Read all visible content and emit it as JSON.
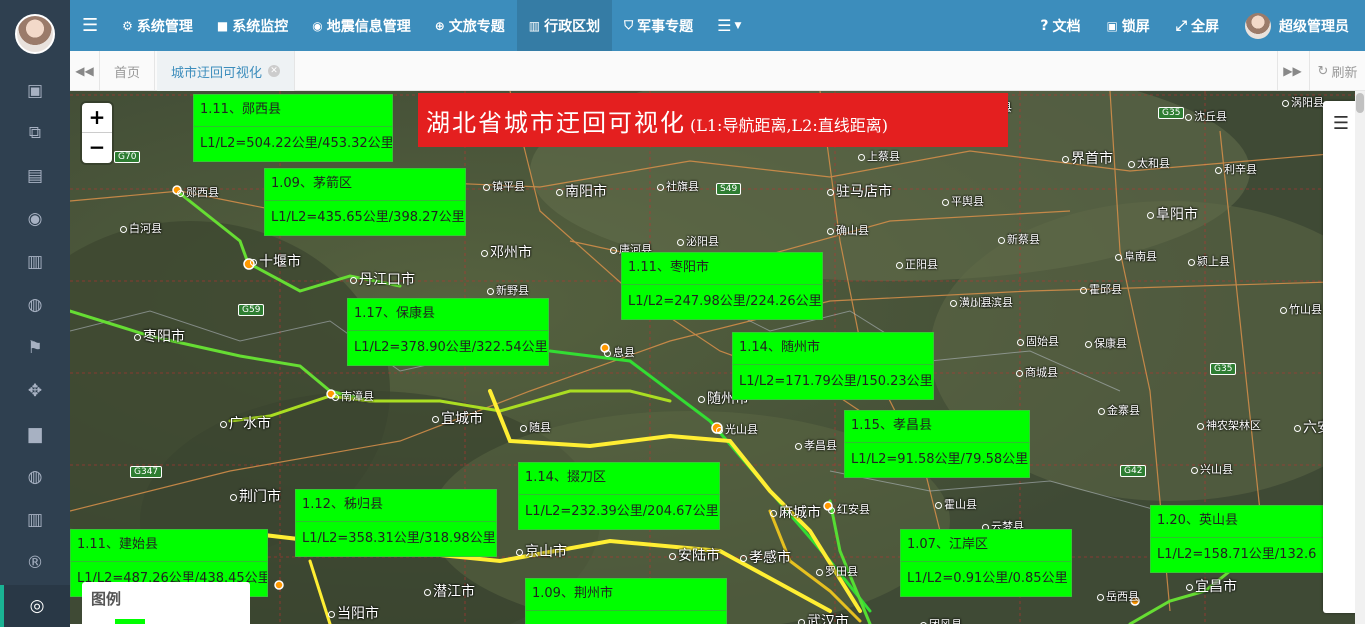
{
  "sidebar": {
    "icons": [
      "screen-icon",
      "layers-icon",
      "map-icon",
      "marker-icon",
      "bar-chart-icon",
      "globe-icon",
      "flag-icon",
      "move-icon",
      "area-chart-icon",
      "globe-icon",
      "bar-chart-icon",
      "registered-icon",
      "lifebuoy-icon"
    ]
  },
  "topbar": {
    "menu": [
      {
        "label": "系统管理",
        "icon": "gear-icon",
        "glyph": "⚙"
      },
      {
        "label": "系统监控",
        "icon": "video-icon",
        "glyph": "■"
      },
      {
        "label": "地震信息管理",
        "icon": "marker-icon",
        "glyph": "◉"
      },
      {
        "label": "文旅专题",
        "icon": "globe-icon",
        "glyph": "⊕"
      },
      {
        "label": "行政区划",
        "icon": "bank-icon",
        "glyph": "▥"
      },
      {
        "label": "军事专题",
        "icon": "shield-icon",
        "glyph": "⛉"
      }
    ],
    "right": {
      "docs": "文档",
      "lock": "锁屏",
      "fullscreen": "全屏",
      "user": "超级管理员"
    }
  },
  "tabs": {
    "home": "首页",
    "current": "城市迂回可视化",
    "refresh": "刷新"
  },
  "map": {
    "title": "湖北省城市迂回可视化",
    "subtitle": "(L1:导航距离,L2:直线距离)",
    "labels": [
      {
        "title": "1.11、郧西县",
        "value": "L1/L2=504.22公里/453.32公里"
      },
      {
        "title": "1.09、茅箭区",
        "value": "L1/L2=435.65公里/398.27公里"
      },
      {
        "title": "1.11、枣阳市",
        "value": "L1/L2=247.98公里/224.26公里"
      },
      {
        "title": "1.17、保康县",
        "value": "L1/L2=378.90公里/322.54公里"
      },
      {
        "title": "1.14、随州市",
        "value": "L1/L2=171.79公里/150.23公里"
      },
      {
        "title": "1.15、孝昌县",
        "value": "L1/L2=91.58公里/79.58公里"
      },
      {
        "title": "1.14、掇刀区",
        "value": "L1/L2=232.39公里/204.67公里"
      },
      {
        "title": "1.12、秭归县",
        "value": "L1/L2=358.31公里/318.98公里"
      },
      {
        "title": "1.11、建始县",
        "value": "L1/L2=487.26公里/438.45公里"
      },
      {
        "title": "1.07、江岸区",
        "value": "L1/L2=0.91公里/0.85公里"
      },
      {
        "title": "1.20、英山县",
        "value": "L1/L2=158.71公里/132.6"
      },
      {
        "title": "1.09、荆州市",
        "value": ""
      }
    ],
    "places": [
      "沁阳县",
      "泌阳县",
      "汝南县",
      "阜阳市",
      "沈丘县",
      "涡阳县",
      "南阳市",
      "驻马店市",
      "上蔡县",
      "界首市",
      "太和县",
      "利辛县",
      "郧西县",
      "十堰市",
      "丹江口市",
      "白河县",
      "镇平县",
      "社旗县",
      "平舆县",
      "邓州市",
      "唐河县",
      "泌阳县",
      "确山县",
      "新蔡县",
      "阜南县",
      "颍上县",
      "新野县",
      "正阳县",
      "淮滨县",
      "霍邱县",
      "竹山县",
      "枣阳市",
      "息县",
      "潢川县",
      "固始县",
      "保康县",
      "南漳县",
      "宜城市",
      "随县",
      "随州市",
      "光山县",
      "商城县",
      "金寨县",
      "神农架林区",
      "广水市",
      "孝昌县",
      "红安县",
      "霍山县",
      "兴山县",
      "荆门市",
      "京山市",
      "安陆市",
      "麻城市",
      "云梦县",
      "孝感市",
      "罗田县",
      "岳西县",
      "宜昌市",
      "当阳市",
      "潜江市",
      "汉川市",
      "武汉市",
      "团风县",
      "六安市"
    ],
    "roads": [
      "G70",
      "G59",
      "S49",
      "G35",
      "G347",
      "G42",
      "G35"
    ],
    "legend": {
      "title": "图例"
    }
  }
}
